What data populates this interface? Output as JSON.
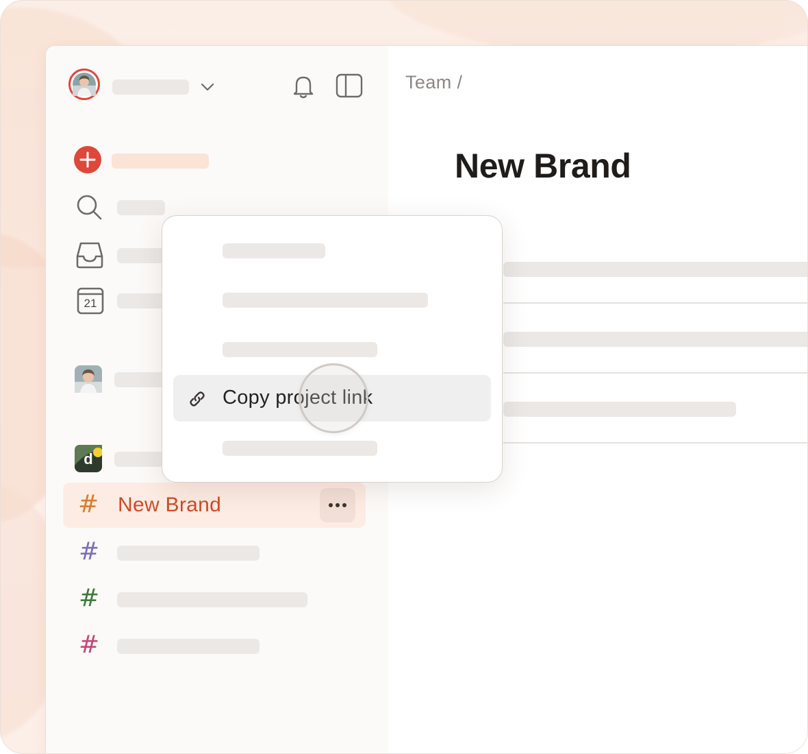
{
  "breadcrumb": "Team /",
  "page_title": "New Brand",
  "context_menu": {
    "copy_link_label": "Copy project link",
    "icon": "link-icon"
  },
  "sidebar": {
    "active_project": {
      "label": "New Brand",
      "icon": "hash-icon",
      "color": "#e07a2b"
    },
    "project_colors": [
      "#7a6fbf",
      "#3f7a3a",
      "#c8457a"
    ],
    "accent_color": "#e0473b",
    "icons": [
      "add-task-icon",
      "search-icon",
      "inbox-icon",
      "calendar-icon",
      "bell-icon",
      "sidebar-toggle-icon",
      "chevron-down-icon",
      "more-icon"
    ],
    "calendar_day": "21"
  }
}
